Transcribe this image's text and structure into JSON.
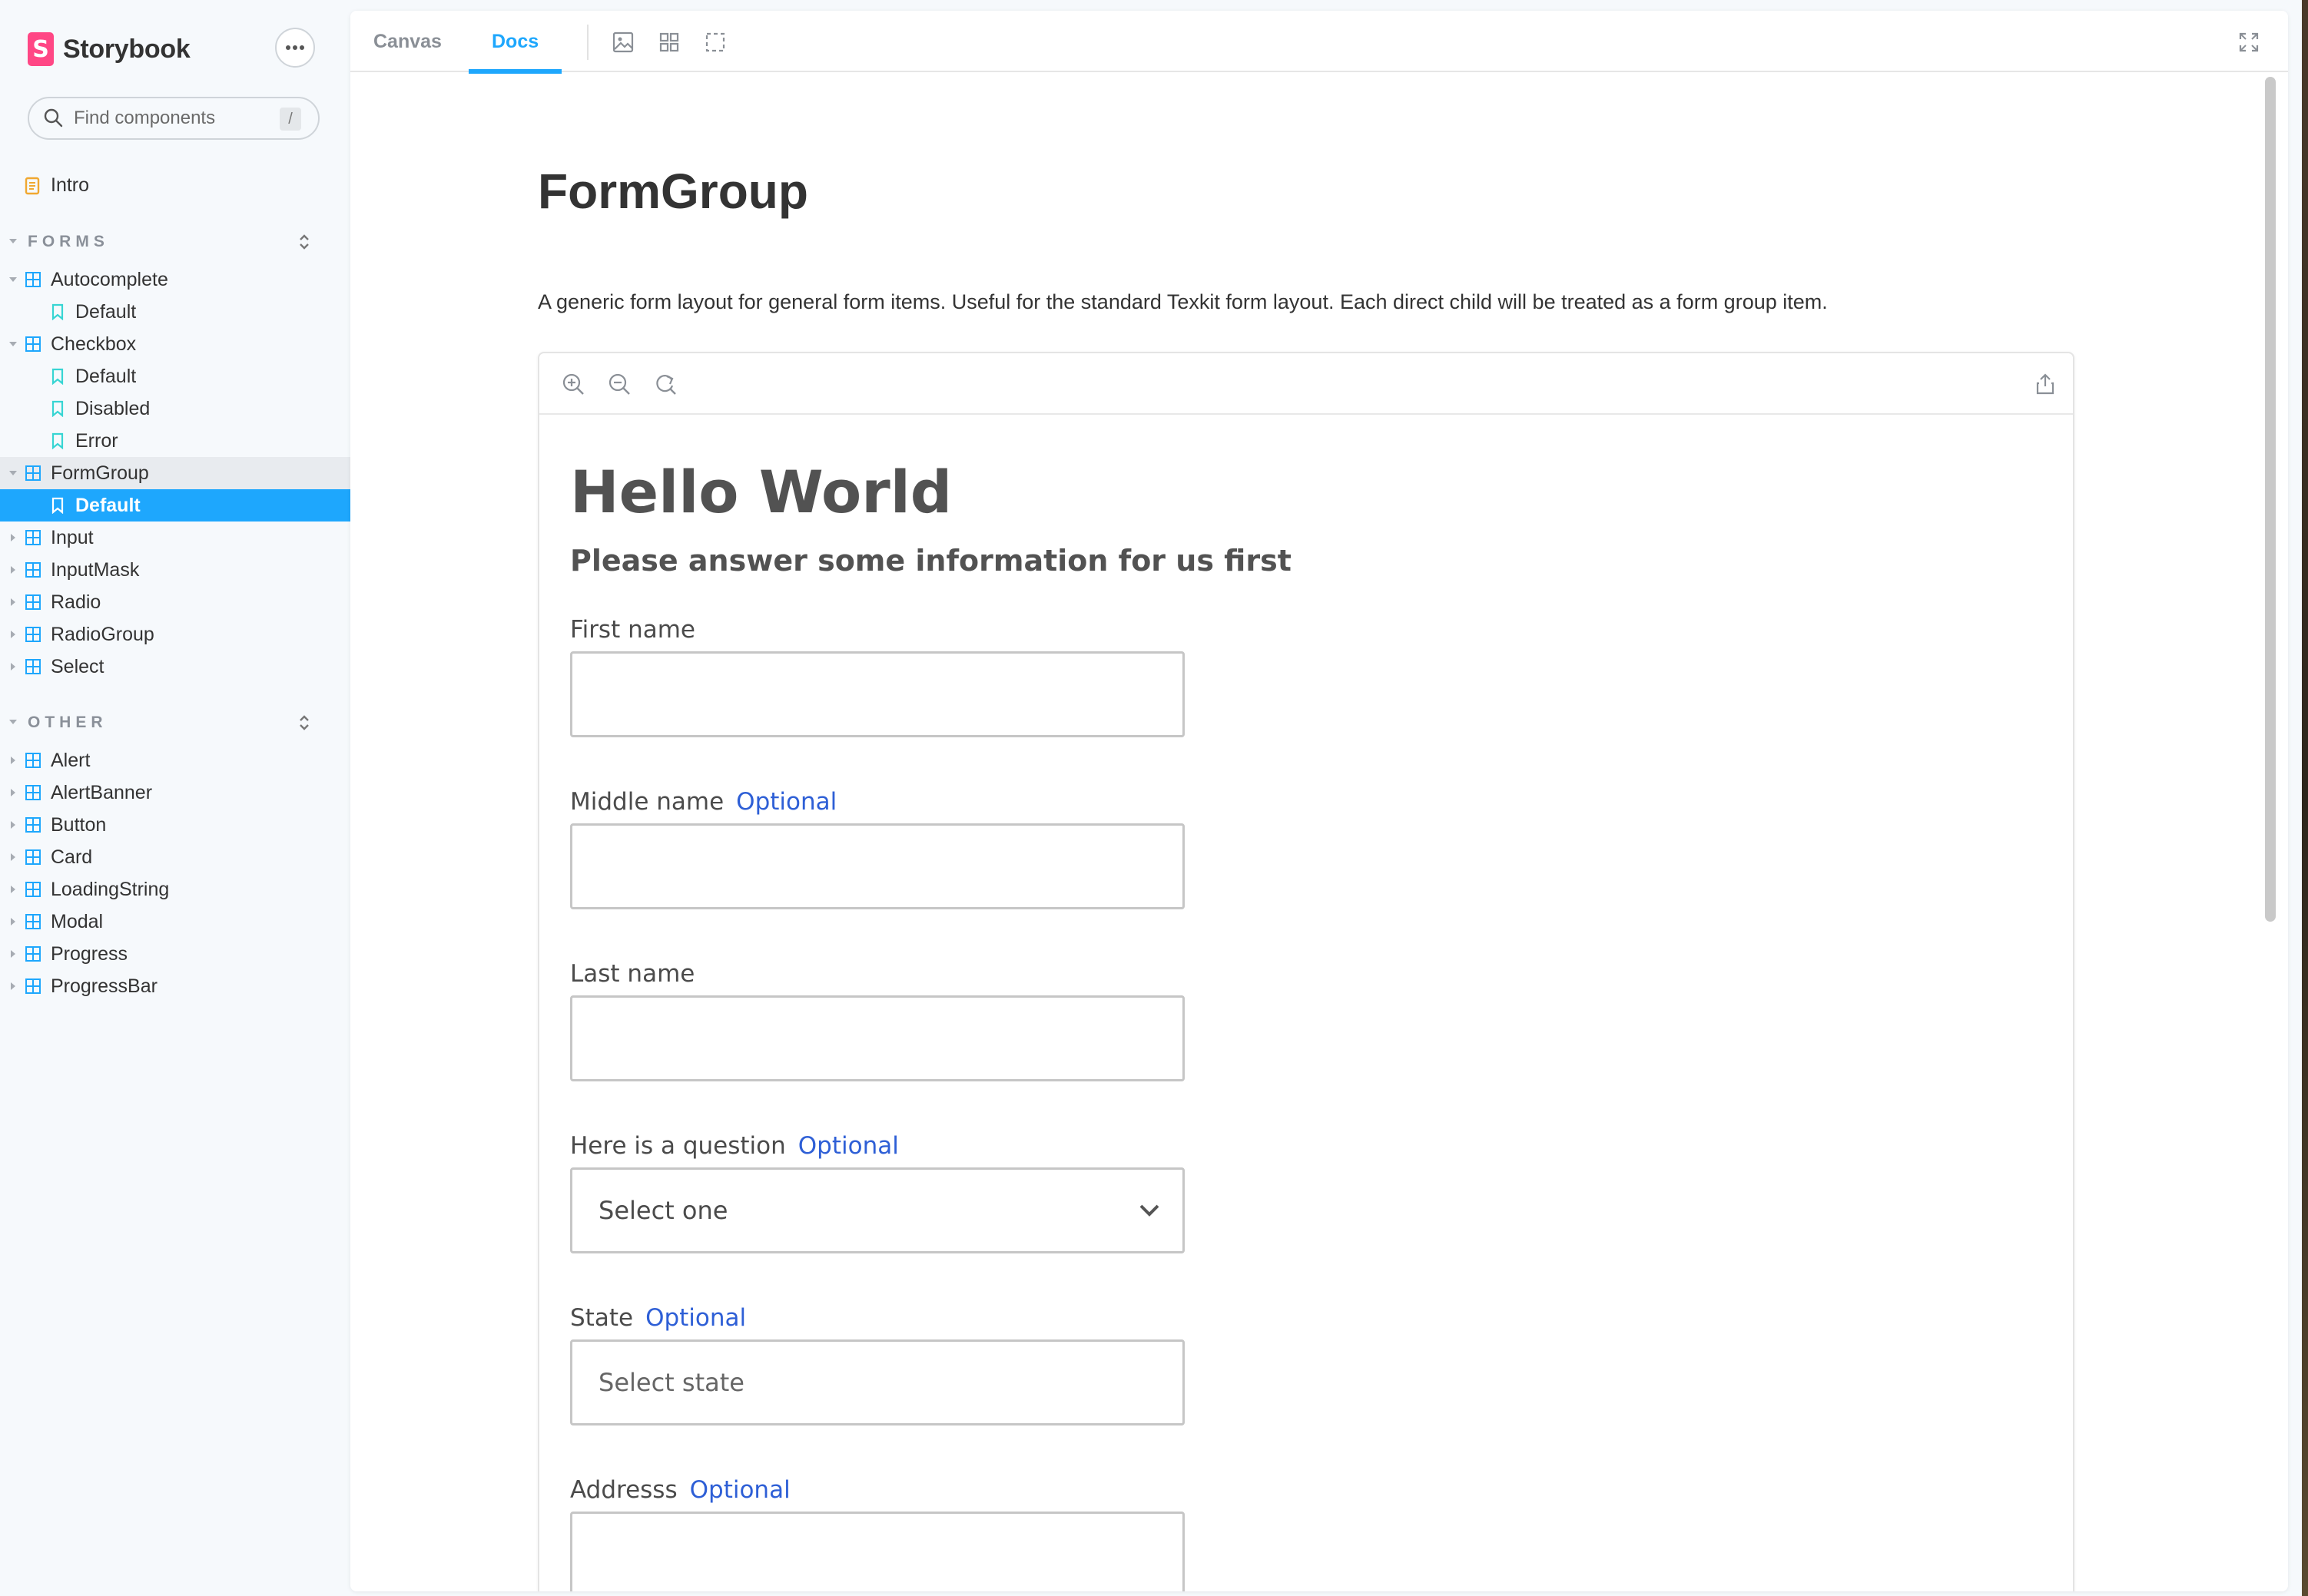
{
  "brand": {
    "name": "Storybook",
    "logo_letter": "S",
    "logo_color": "#ff4785"
  },
  "search": {
    "placeholder": "Find components",
    "shortcut": "/"
  },
  "sidebar": {
    "intro_label": "Intro",
    "sections": [
      {
        "title": "FORMS",
        "items": [
          {
            "label": "Autocomplete",
            "expanded": true
          },
          {
            "label": "Default",
            "story": true
          },
          {
            "label": "Checkbox",
            "expanded": true
          },
          {
            "label": "Default",
            "story": true
          },
          {
            "label": "Disabled",
            "story": true
          },
          {
            "label": "Error",
            "story": true
          },
          {
            "label": "FormGroup",
            "expanded": true
          },
          {
            "label": "Default",
            "story": true,
            "selected": true
          },
          {
            "label": "Input"
          },
          {
            "label": "InputMask"
          },
          {
            "label": "Radio"
          },
          {
            "label": "RadioGroup"
          },
          {
            "label": "Select"
          }
        ]
      },
      {
        "title": "OTHER",
        "items": [
          {
            "label": "Alert"
          },
          {
            "label": "AlertBanner"
          },
          {
            "label": "Button"
          },
          {
            "label": "Card"
          },
          {
            "label": "LoadingString"
          },
          {
            "label": "Modal"
          },
          {
            "label": "Progress"
          },
          {
            "label": "ProgressBar"
          }
        ]
      }
    ]
  },
  "toolbar": {
    "tabs": [
      "Canvas",
      "Docs"
    ],
    "active_tab": "Docs",
    "accent": "#1ea7fd"
  },
  "docs": {
    "title": "FormGroup",
    "description": "A generic form layout for general form items. Useful for the standard Texkit form layout. Each direct child will be treated as a form group item."
  },
  "story": {
    "heading": "Hello World",
    "subheading": "Please answer some information for us first",
    "optional_label": "Optional",
    "optional_color": "#2e5fd6",
    "fields": {
      "first_name": {
        "label": "First name",
        "value": ""
      },
      "middle_name": {
        "label": "Middle name",
        "value": ""
      },
      "last_name": {
        "label": "Last name",
        "value": ""
      },
      "question": {
        "label": "Here is a question",
        "selected": "Select one"
      },
      "state": {
        "label": "State",
        "placeholder": "Select state"
      },
      "address": {
        "label": "Addresss",
        "value": ""
      }
    }
  }
}
